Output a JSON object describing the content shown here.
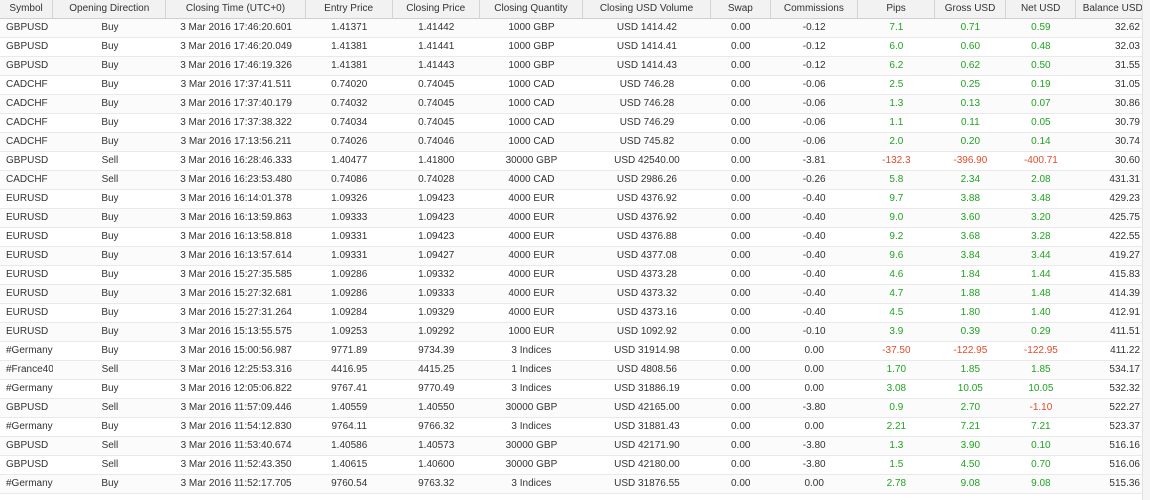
{
  "columns": [
    "Symbol",
    "Opening Direction",
    "Closing Time (UTC+0)",
    "Entry Price",
    "Closing Price",
    "Closing Quantity",
    "Closing USD Volume",
    "Swap",
    "Commissions",
    "Pips",
    "Gross USD",
    "Net USD",
    "Balance USD"
  ],
  "colors": {
    "positive": "#21a321",
    "negative": "#e34b2a"
  },
  "rows": [
    [
      "GBPUSD",
      "Buy",
      "3 Mar 2016 17:46:20.601",
      "1.41371",
      "1.41442",
      "1000 GBP",
      "USD 1414.42",
      "0.00",
      "-0.12",
      "7.1",
      "0.71",
      "0.59",
      "32.62"
    ],
    [
      "GBPUSD",
      "Buy",
      "3 Mar 2016 17:46:20.049",
      "1.41381",
      "1.41441",
      "1000 GBP",
      "USD 1414.41",
      "0.00",
      "-0.12",
      "6.0",
      "0.60",
      "0.48",
      "32.03"
    ],
    [
      "GBPUSD",
      "Buy",
      "3 Mar 2016 17:46:19.326",
      "1.41381",
      "1.41443",
      "1000 GBP",
      "USD 1414.43",
      "0.00",
      "-0.12",
      "6.2",
      "0.62",
      "0.50",
      "31.55"
    ],
    [
      "CADCHF",
      "Buy",
      "3 Mar 2016 17:37:41.511",
      "0.74020",
      "0.74045",
      "1000 CAD",
      "USD 746.28",
      "0.00",
      "-0.06",
      "2.5",
      "0.25",
      "0.19",
      "31.05"
    ],
    [
      "CADCHF",
      "Buy",
      "3 Mar 2016 17:37:40.179",
      "0.74032",
      "0.74045",
      "1000 CAD",
      "USD 746.28",
      "0.00",
      "-0.06",
      "1.3",
      "0.13",
      "0.07",
      "30.86"
    ],
    [
      "CADCHF",
      "Buy",
      "3 Mar 2016 17:37:38.322",
      "0.74034",
      "0.74045",
      "1000 CAD",
      "USD 746.29",
      "0.00",
      "-0.06",
      "1.1",
      "0.11",
      "0.05",
      "30.79"
    ],
    [
      "CADCHF",
      "Buy",
      "3 Mar 2016 17:13:56.211",
      "0.74026",
      "0.74046",
      "1000 CAD",
      "USD 745.82",
      "0.00",
      "-0.06",
      "2.0",
      "0.20",
      "0.14",
      "30.74"
    ],
    [
      "GBPUSD",
      "Sell",
      "3 Mar 2016 16:28:46.333",
      "1.40477",
      "1.41800",
      "30000 GBP",
      "USD 42540.00",
      "0.00",
      "-3.81",
      "-132.3",
      "-396.90",
      "-400.71",
      "30.60"
    ],
    [
      "CADCHF",
      "Sell",
      "3 Mar 2016 16:23:53.480",
      "0.74086",
      "0.74028",
      "4000 CAD",
      "USD 2986.26",
      "0.00",
      "-0.26",
      "5.8",
      "2.34",
      "2.08",
      "431.31"
    ],
    [
      "EURUSD",
      "Buy",
      "3 Mar 2016 16:14:01.378",
      "1.09326",
      "1.09423",
      "4000 EUR",
      "USD 4376.92",
      "0.00",
      "-0.40",
      "9.7",
      "3.88",
      "3.48",
      "429.23"
    ],
    [
      "EURUSD",
      "Buy",
      "3 Mar 2016 16:13:59.863",
      "1.09333",
      "1.09423",
      "4000 EUR",
      "USD 4376.92",
      "0.00",
      "-0.40",
      "9.0",
      "3.60",
      "3.20",
      "425.75"
    ],
    [
      "EURUSD",
      "Buy",
      "3 Mar 2016 16:13:58.818",
      "1.09331",
      "1.09423",
      "4000 EUR",
      "USD 4376.88",
      "0.00",
      "-0.40",
      "9.2",
      "3.68",
      "3.28",
      "422.55"
    ],
    [
      "EURUSD",
      "Buy",
      "3 Mar 2016 16:13:57.614",
      "1.09331",
      "1.09427",
      "4000 EUR",
      "USD 4377.08",
      "0.00",
      "-0.40",
      "9.6",
      "3.84",
      "3.44",
      "419.27"
    ],
    [
      "EURUSD",
      "Buy",
      "3 Mar 2016 15:27:35.585",
      "1.09286",
      "1.09332",
      "4000 EUR",
      "USD 4373.28",
      "0.00",
      "-0.40",
      "4.6",
      "1.84",
      "1.44",
      "415.83"
    ],
    [
      "EURUSD",
      "Buy",
      "3 Mar 2016 15:27:32.681",
      "1.09286",
      "1.09333",
      "4000 EUR",
      "USD 4373.32",
      "0.00",
      "-0.40",
      "4.7",
      "1.88",
      "1.48",
      "414.39"
    ],
    [
      "EURUSD",
      "Buy",
      "3 Mar 2016 15:27:31.264",
      "1.09284",
      "1.09329",
      "4000 EUR",
      "USD 4373.16",
      "0.00",
      "-0.40",
      "4.5",
      "1.80",
      "1.40",
      "412.91"
    ],
    [
      "EURUSD",
      "Buy",
      "3 Mar 2016 15:13:55.575",
      "1.09253",
      "1.09292",
      "1000 EUR",
      "USD 1092.92",
      "0.00",
      "-0.10",
      "3.9",
      "0.39",
      "0.29",
      "411.51"
    ],
    [
      "#Germany30",
      "Buy",
      "3 Mar 2016 15:00:56.987",
      "9771.89",
      "9734.39",
      "3 Indices",
      "USD 31914.98",
      "0.00",
      "0.00",
      "-37.50",
      "-122.95",
      "-122.95",
      "411.22"
    ],
    [
      "#France40",
      "Sell",
      "3 Mar 2016 12:25:53.316",
      "4416.95",
      "4415.25",
      "1 Indices",
      "USD 4808.56",
      "0.00",
      "0.00",
      "1.70",
      "1.85",
      "1.85",
      "534.17"
    ],
    [
      "#Germany30",
      "Buy",
      "3 Mar 2016 12:05:06.822",
      "9767.41",
      "9770.49",
      "3 Indices",
      "USD 31886.19",
      "0.00",
      "0.00",
      "3.08",
      "10.05",
      "10.05",
      "532.32"
    ],
    [
      "GBPUSD",
      "Sell",
      "3 Mar 2016 11:57:09.446",
      "1.40559",
      "1.40550",
      "30000 GBP",
      "USD 42165.00",
      "0.00",
      "-3.80",
      "0.9",
      "2.70",
      "-1.10",
      "522.27"
    ],
    [
      "#Germany30",
      "Buy",
      "3 Mar 2016 11:54:12.830",
      "9764.11",
      "9766.32",
      "3 Indices",
      "USD 31881.43",
      "0.00",
      "0.00",
      "2.21",
      "7.21",
      "7.21",
      "523.37"
    ],
    [
      "GBPUSD",
      "Sell",
      "3 Mar 2016 11:53:40.674",
      "1.40586",
      "1.40573",
      "30000 GBP",
      "USD 42171.90",
      "0.00",
      "-3.80",
      "1.3",
      "3.90",
      "0.10",
      "516.16"
    ],
    [
      "GBPUSD",
      "Sell",
      "3 Mar 2016 11:52:43.350",
      "1.40615",
      "1.40600",
      "30000 GBP",
      "USD 42180.00",
      "0.00",
      "-3.80",
      "1.5",
      "4.50",
      "0.70",
      "516.06"
    ],
    [
      "#Germany30",
      "Buy",
      "3 Mar 2016 11:52:17.705",
      "9760.54",
      "9763.32",
      "3 Indices",
      "USD 31876.55",
      "0.00",
      "0.00",
      "2.78",
      "9.08",
      "9.08",
      "515.36"
    ]
  ]
}
